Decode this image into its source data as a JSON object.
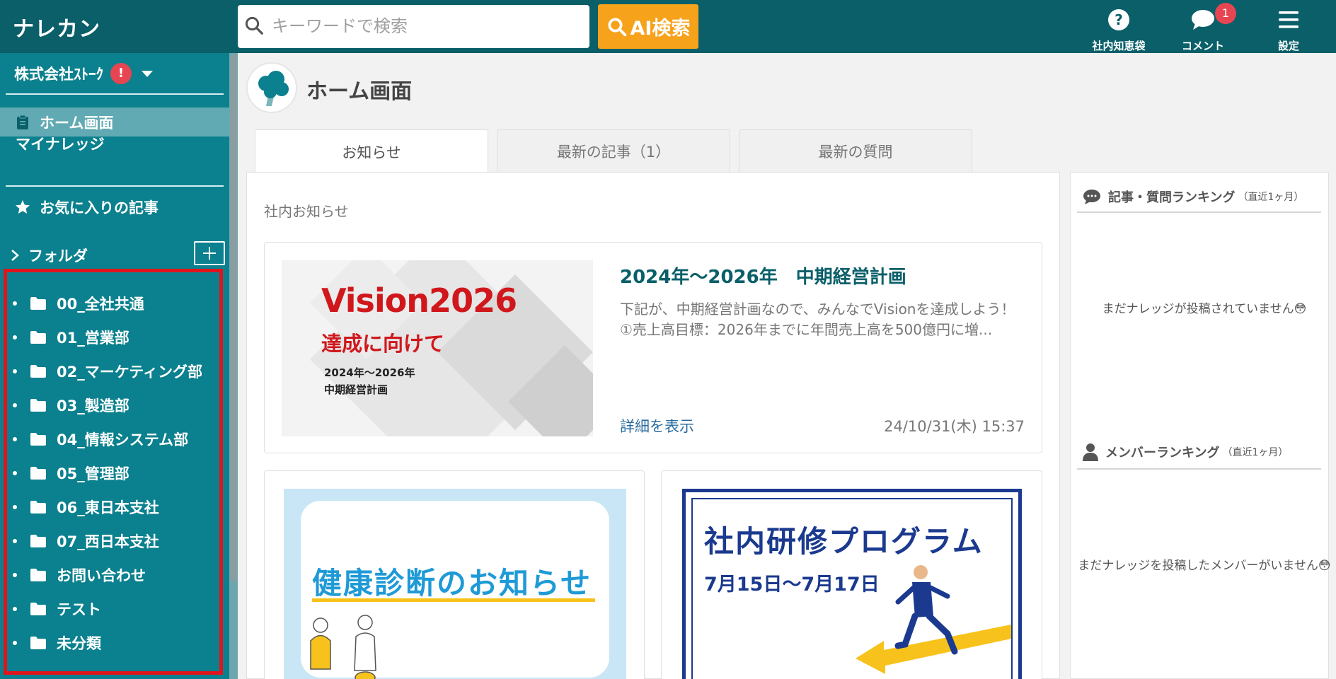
{
  "header": {
    "logo": "ナレカン",
    "search_placeholder": "キーワードで検索",
    "ai_search_label": "AI検索",
    "nav": [
      {
        "label": "社内知恵袋",
        "icon": "question-circle-icon"
      },
      {
        "label": "コメント",
        "icon": "comment-bubble-icon",
        "badge": "1"
      },
      {
        "label": "設定",
        "icon": "hamburger-menu-icon"
      }
    ]
  },
  "sidebar": {
    "company": "株式会社ｽﾄｰｸ",
    "company_alert": "!",
    "home_label": "ホーム画面",
    "my_knowledge_label": "マイナレッジ",
    "favorites_label": "お気に入りの記事",
    "folder_header": "フォルダ",
    "folders": [
      "00_全社共通",
      "01_営業部",
      "02_マーケティング部",
      "03_製造部",
      "04_情報システム部",
      "05_管理部",
      "06_東日本支社",
      "07_西日本支社",
      "お問い合わせ",
      "テスト",
      "未分類"
    ]
  },
  "main": {
    "page_title": "ホーム画面",
    "tabs": [
      "お知らせ",
      "最新の記事（1）",
      "最新の質問"
    ],
    "active_tab": 0,
    "section_label": "社内お知らせ",
    "featured": {
      "image_title": "Vision2026",
      "image_subtitle": "達成に向けて",
      "image_line1": "2024年～2026年",
      "image_line2": "中期経営計画",
      "title": "2024年～2026年　中期経営計画",
      "body_line1": "下記が、中期経営計画なので、みんなでVisionを達成しよう！",
      "body_line2": "①売上高目標：2026年までに年間売上高を500億円に増...",
      "link": "詳細を表示",
      "date": "24/10/31(木) 15:37"
    },
    "card_health_text": "健康診断のお知らせ",
    "card_training_title": "社内研修プログラム",
    "card_training_date": "7月15日～7月17日"
  },
  "right": {
    "ranking_title": "記事・質問ランキング",
    "ranking_period": "（直近1ヶ月）",
    "ranking_empty": "まだナレッジが投稿されていません😳",
    "member_title": "メンバーランキング",
    "member_period": "（直近1ヶ月）",
    "member_empty": "まだナレッジを投稿したメンバーがいません😳"
  },
  "colors": {
    "header_bg": "#0a5f69",
    "sidebar_bg": "#0b808e",
    "accent_orange": "#f7a21b",
    "alert_red": "#e64552",
    "highlight_red": "#e1141c"
  }
}
